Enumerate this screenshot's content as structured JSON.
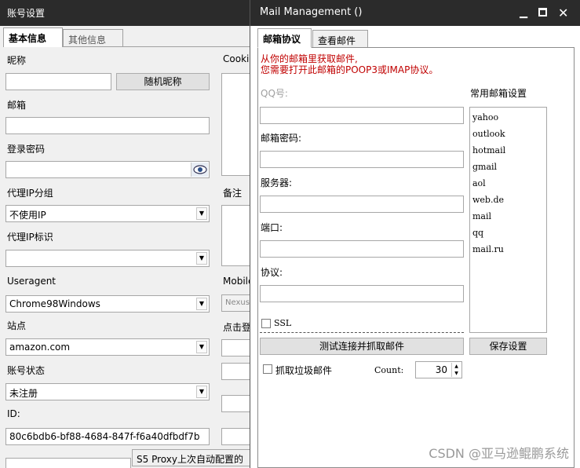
{
  "bg_window": {
    "title": "账号设置",
    "tabs": [
      "基本信息",
      "其他信息"
    ],
    "nickname_label": "昵称",
    "random_nickname_button": "随机昵称",
    "email_label": "邮箱",
    "login_password_label": "登录密码",
    "proxy_group_label": "代理IP分组",
    "proxy_group_value": "不使用IP",
    "proxy_id_label": "代理IP标识",
    "useragent_label": "Useragent",
    "useragent_value": "Chrome98Windows",
    "site_label": "站点",
    "site_value": "amazon.com",
    "account_status_label": "账号状态",
    "account_status_value": "未注册",
    "id_label": "ID:",
    "id_value": "80c6bdb6-bf88-4684-847f-f6a40dfbdf7b",
    "cookie_label": "Cooki",
    "note_label": "备注",
    "mobile_label": "Mobile",
    "mobile_value": "Nexus",
    "click_label": "点击登",
    "proxy_hint": "S5 Proxy上次自动配置的"
  },
  "modal": {
    "title": "Mail Management ()",
    "tabs": [
      "邮箱协议",
      "查看邮件"
    ],
    "hint_line1": "从你的邮箱里获取邮件,",
    "hint_line2": "您需要打开此邮箱的POOP3或IMAP协议。",
    "qq_label": "QQ号:",
    "password_label": "邮箱密码:",
    "server_label": "服务器:",
    "port_label": "端口:",
    "protocol_label": "协议:",
    "ssl_label": "SSL",
    "test_button": "测试连接并抓取邮件",
    "junk_label": "抓取垃圾邮件",
    "count_label": "Count:",
    "count_value": "30",
    "common_label": "常用邮箱设置",
    "common_list": [
      "yahoo",
      "outlook",
      "hotmail",
      "gmail",
      "aol",
      "web.de",
      "mail",
      "qq",
      "mail.ru"
    ],
    "save_button": "保存设置"
  },
  "watermark": "CSDN @亚马逊鲲鹏系统"
}
